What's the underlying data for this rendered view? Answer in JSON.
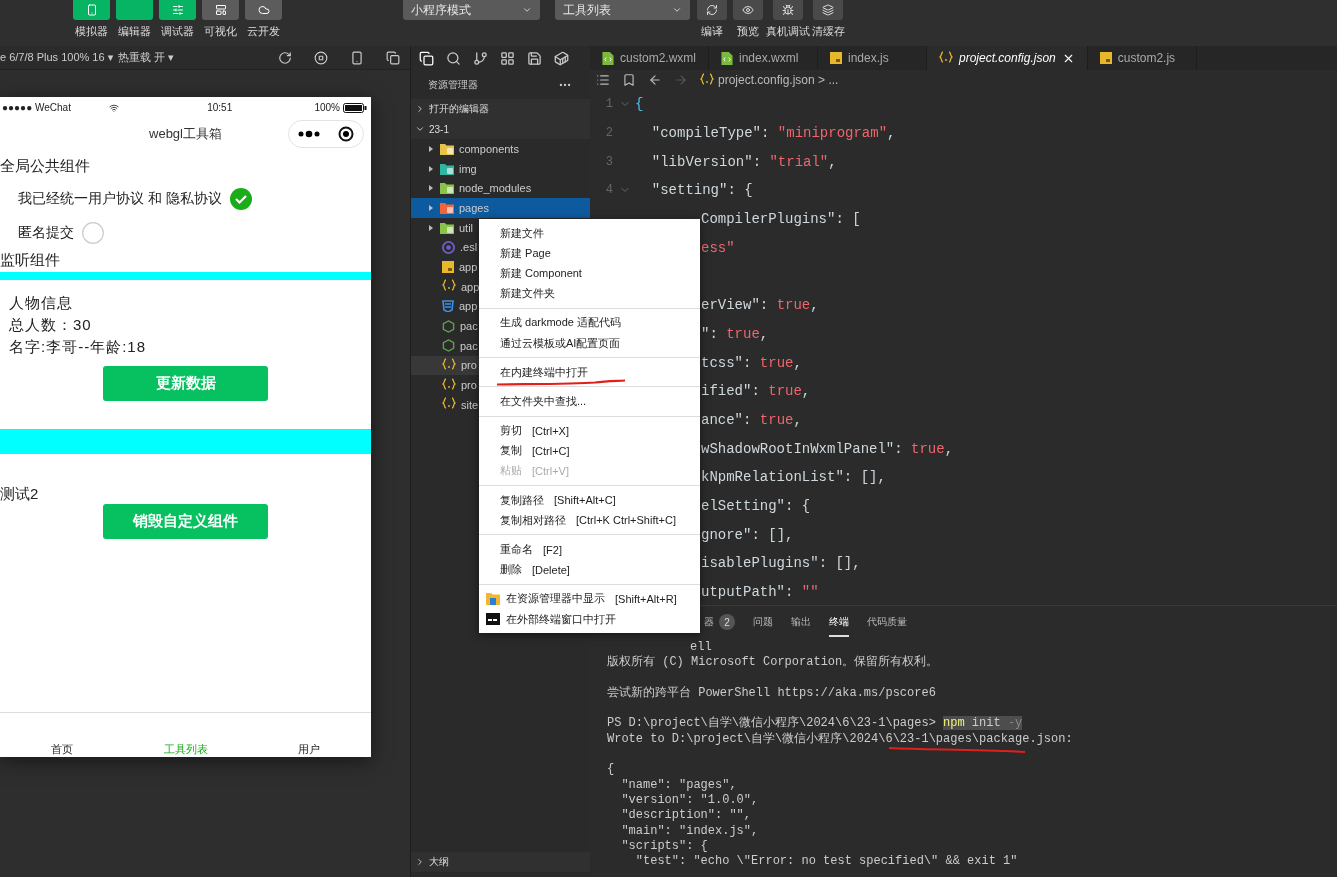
{
  "toolbar": {
    "modes": [
      {
        "label": "模拟器",
        "kind": "phone",
        "on": true
      },
      {
        "label": "编辑器",
        "kind": "code",
        "on": true
      },
      {
        "label": "调试器",
        "kind": "sliders",
        "on": true
      },
      {
        "label": "可视化",
        "kind": "layout",
        "on": false
      },
      {
        "label": "云开发",
        "kind": "cloud",
        "on": false
      }
    ],
    "dropdowns": [
      "小程序模式",
      "工具列表"
    ],
    "actions": [
      {
        "label": "编译",
        "kind": "compile"
      },
      {
        "label": "预览",
        "kind": "preview"
      },
      {
        "label": "真机调试",
        "kind": "debug"
      },
      {
        "label": "清缓存",
        "kind": "cache"
      }
    ]
  },
  "simulator_bar": {
    "device": "e 6/7/8 Plus 100% 16 ▾",
    "hot_reload": "热重载 开 ▾"
  },
  "phone": {
    "status": {
      "carrier": "●●●●● WeChat",
      "time": "10:51",
      "battery": "100%"
    },
    "title": "webgl工具箱",
    "sections": [
      {
        "kind": "heading",
        "text": "全局公共组件"
      },
      {
        "kind": "check",
        "text": "我已经统一用户协议 和 隐私协议",
        "checked": true
      },
      {
        "kind": "check",
        "text": "匿名提交",
        "checked": false
      },
      {
        "kind": "heading",
        "text": "监听组件"
      },
      {
        "kind": "bar"
      },
      {
        "kind": "info",
        "text": "人物信息"
      },
      {
        "kind": "info",
        "text": "总人数：30"
      },
      {
        "kind": "info",
        "text": "名字:李哥--年龄:18"
      },
      {
        "kind": "button",
        "text": "更新数据"
      },
      {
        "kind": "wide-bar"
      },
      {
        "kind": "heading",
        "text": "测试2"
      },
      {
        "kind": "button",
        "text": "销毁自定义组件"
      }
    ],
    "tabbar": [
      {
        "label": "首页",
        "selected": false
      },
      {
        "label": "工具列表",
        "selected": true
      },
      {
        "label": "用户",
        "selected": false
      }
    ]
  },
  "explorer": {
    "title": "资源管理器",
    "sections": [
      {
        "label": "打开的编辑器",
        "expanded": false
      },
      {
        "label": "23-1",
        "expanded": true
      }
    ],
    "tree": [
      {
        "name": "components",
        "kind": "folder",
        "color": "#e8c14a",
        "selected": false,
        "hovered": false
      },
      {
        "name": "img",
        "kind": "folder",
        "color": "#2fb5a0",
        "selected": false,
        "hovered": false
      },
      {
        "name": "node_modules",
        "kind": "folder",
        "color": "#8bc34a",
        "selected": false,
        "hovered": false
      },
      {
        "name": "pages",
        "kind": "folder",
        "color": "#f0643c",
        "selected": true,
        "hovered": false
      },
      {
        "name": "util",
        "kind": "folder",
        "color": "#8bc34a",
        "selected": false,
        "hovered": false
      },
      {
        "name": ".esl",
        "kind": "eslint",
        "selected": false,
        "hovered": false
      },
      {
        "name": "app",
        "kind": "js",
        "selected": false,
        "hovered": false
      },
      {
        "name": "app",
        "kind": "json",
        "selected": false,
        "hovered": false
      },
      {
        "name": "app",
        "kind": "css",
        "selected": false,
        "hovered": false
      },
      {
        "name": "pac",
        "kind": "node",
        "selected": false,
        "hovered": false
      },
      {
        "name": "pac",
        "kind": "node",
        "selected": false,
        "hovered": false
      },
      {
        "name": "pro",
        "kind": "json",
        "selected": false,
        "hovered": true
      },
      {
        "name": "pro",
        "kind": "json",
        "selected": false,
        "hovered": false
      },
      {
        "name": "site",
        "kind": "json",
        "selected": false,
        "hovered": false
      }
    ],
    "outline": "大纲"
  },
  "editor": {
    "tabs": [
      {
        "label": "custom2.wxml",
        "kind": "wxml",
        "selected": false
      },
      {
        "label": "index.wxml",
        "kind": "wxml",
        "selected": false
      },
      {
        "label": "index.js",
        "kind": "js",
        "selected": false
      },
      {
        "label": "project.config.json",
        "kind": "json",
        "selected": true
      },
      {
        "label": "custom2.js",
        "kind": "js",
        "selected": false
      }
    ],
    "breadcrumb": "project.config.json > ...",
    "lines": [
      {
        "number": "1",
        "fold": true,
        "kind": "full",
        "tokens": [
          {
            "text": "{",
            "kind": "brace"
          }
        ]
      },
      {
        "number": "2",
        "fold": false,
        "kind": "full",
        "tokens": [
          {
            "text": "  \"compileType\"",
            "kind": "key"
          },
          {
            "text": ": ",
            "kind": "punct"
          },
          {
            "text": "\"miniprogram\"",
            "kind": "string"
          },
          {
            "text": ",",
            "kind": "punct"
          }
        ]
      },
      {
        "number": "3",
        "fold": false,
        "kind": "full",
        "tokens": [
          {
            "text": "  \"libVersion\"",
            "kind": "key"
          },
          {
            "text": ": ",
            "kind": "punct"
          },
          {
            "text": "\"trial\"",
            "kind": "string"
          },
          {
            "text": ",",
            "kind": "punct"
          }
        ]
      },
      {
        "number": "4",
        "fold": true,
        "kind": "full",
        "tokens": [
          {
            "text": "  \"setting\"",
            "kind": "key"
          },
          {
            "text": ": {",
            "kind": "punct"
          }
        ]
      },
      {
        "kind": "covered",
        "tokens": [
          {
            "text": "CompilerPlugins\"",
            "kind": "key"
          },
          {
            "text": ": [",
            "kind": "punct"
          }
        ]
      },
      {
        "kind": "covered",
        "tokens": [
          {
            "text": "ess\"",
            "kind": "string"
          }
        ]
      },
      {
        "kind": "covered"
      },
      {
        "kind": "covered",
        "tokens": [
          {
            "text": "erView\"",
            "kind": "key"
          },
          {
            "text": ": ",
            "kind": "punct"
          },
          {
            "text": "true",
            "kind": "bool"
          },
          {
            "text": ",",
            "kind": "punct"
          }
        ]
      },
      {
        "kind": "covered",
        "tokens": [
          {
            "text": "\"",
            "kind": "key"
          },
          {
            "text": ": ",
            "kind": "punct"
          },
          {
            "text": "true",
            "kind": "bool"
          },
          {
            "text": ",",
            "kind": "punct"
          }
        ]
      },
      {
        "kind": "covered",
        "tokens": [
          {
            "text": "tcss\"",
            "kind": "key"
          },
          {
            "text": ": ",
            "kind": "punct"
          },
          {
            "text": "true",
            "kind": "bool"
          },
          {
            "text": ",",
            "kind": "punct"
          }
        ]
      },
      {
        "kind": "covered",
        "tokens": [
          {
            "text": "ified\"",
            "kind": "key"
          },
          {
            "text": ": ",
            "kind": "punct"
          },
          {
            "text": "true",
            "kind": "bool"
          },
          {
            "text": ",",
            "kind": "punct"
          }
        ]
      },
      {
        "kind": "covered",
        "tokens": [
          {
            "text": "ance\"",
            "kind": "key"
          },
          {
            "text": ": ",
            "kind": "punct"
          },
          {
            "text": "true",
            "kind": "bool"
          },
          {
            "text": ",",
            "kind": "punct"
          }
        ]
      },
      {
        "kind": "covered",
        "tokens": [
          {
            "text": "wShadowRootInWxmlPanel\"",
            "kind": "key"
          },
          {
            "text": ": ",
            "kind": "punct"
          },
          {
            "text": "true",
            "kind": "bool"
          },
          {
            "text": ",",
            "kind": "punct"
          }
        ]
      },
      {
        "kind": "covered",
        "tokens": [
          {
            "text": "kNpmRelationList\"",
            "kind": "key"
          },
          {
            "text": ": [],",
            "kind": "punct"
          }
        ]
      },
      {
        "kind": "covered",
        "tokens": [
          {
            "text": "elSetting\"",
            "kind": "key"
          },
          {
            "text": ": {",
            "kind": "punct"
          }
        ]
      },
      {
        "kind": "covered",
        "tokens": [
          {
            "text": "gnore\"",
            "kind": "key"
          },
          {
            "text": ": [],",
            "kind": "punct"
          }
        ]
      },
      {
        "kind": "covered",
        "tokens": [
          {
            "text": "isablePlugins\"",
            "kind": "key"
          },
          {
            "text": ": [],",
            "kind": "punct"
          }
        ]
      },
      {
        "kind": "covered",
        "tokens": [
          {
            "text": "utputPath\"",
            "kind": "key"
          },
          {
            "text": ": ",
            "kind": "punct"
          },
          {
            "text": "\"\"",
            "kind": "string"
          }
        ]
      }
    ]
  },
  "panel": {
    "tabs": [
      {
        "label": "器",
        "badge": "2",
        "selected": false
      },
      {
        "label": "问题",
        "selected": false
      },
      {
        "label": "输出",
        "selected": false
      },
      {
        "label": "终端",
        "selected": true
      },
      {
        "label": "代码质量",
        "selected": false
      }
    ],
    "lines": [
      {
        "kind": "covered",
        "segments": [
          {
            "text": "ell",
            "kind": "plain"
          }
        ]
      },
      {
        "kind": "text",
        "segments": [
          {
            "text": "版权所有 (C) Microsoft Corporation。保留所有权利。",
            "kind": "plain"
          }
        ]
      },
      {
        "kind": "blank"
      },
      {
        "kind": "text",
        "segments": [
          {
            "text": "尝试新的跨平台 PowerShell https://aka.ms/pscore6",
            "kind": "plain"
          }
        ]
      },
      {
        "kind": "blank"
      },
      {
        "kind": "text",
        "segments": [
          {
            "text": "PS D:\\project\\自学\\微信小程序\\2024\\6\\23-1\\pages> ",
            "kind": "plain"
          },
          {
            "text": "npm",
            "kind": "command"
          },
          {
            "text": " init ",
            "kind": "selected"
          },
          {
            "text": "-y",
            "kind": "flag"
          }
        ]
      },
      {
        "kind": "text",
        "annotated": true,
        "segments": [
          {
            "text": "Wrote to D:\\project\\自学\\微信小程序\\2024\\6\\23-1\\pages\\package.json:",
            "kind": "plain"
          }
        ]
      },
      {
        "kind": "blank"
      },
      {
        "kind": "text",
        "segments": [
          {
            "text": "{",
            "kind": "plain"
          }
        ]
      },
      {
        "kind": "text",
        "segments": [
          {
            "text": "  \"name\": \"pages\",",
            "kind": "plain"
          }
        ]
      },
      {
        "kind": "text",
        "segments": [
          {
            "text": "  \"version\": \"1.0.0\",",
            "kind": "plain"
          }
        ]
      },
      {
        "kind": "text",
        "segments": [
          {
            "text": "  \"description\": \"\",",
            "kind": "plain"
          }
        ]
      },
      {
        "kind": "text",
        "segments": [
          {
            "text": "  \"main\": \"index.js\",",
            "kind": "plain"
          }
        ]
      },
      {
        "kind": "text",
        "segments": [
          {
            "text": "  \"scripts\": {",
            "kind": "plain"
          }
        ]
      },
      {
        "kind": "text",
        "segments": [
          {
            "text": "    \"test\": \"echo \\\"Error: no test specified\\\" && exit 1\"",
            "kind": "plain"
          }
        ]
      }
    ]
  },
  "context_menu": {
    "groups": [
      [
        {
          "label": "新建文件",
          "kind": "plain",
          "disabled": false,
          "annotated": false
        },
        {
          "label": "新建 Page",
          "kind": "plain",
          "disabled": false,
          "annotated": false
        },
        {
          "label": "新建 Component",
          "kind": "plain",
          "disabled": false,
          "annotated": false
        },
        {
          "label": "新建文件夹",
          "kind": "plain",
          "disabled": false,
          "annotated": false
        }
      ],
      [
        {
          "label": "生成 darkmode 适配代码",
          "kind": "plain",
          "disabled": false,
          "annotated": false
        },
        {
          "label": "通过云模板或AI配置页面",
          "kind": "plain",
          "disabled": false,
          "annotated": false
        }
      ],
      [
        {
          "label": "在内建终端中打开",
          "kind": "plain",
          "disabled": false,
          "annotated": true
        }
      ],
      [
        {
          "label": "在文件夹中查找...",
          "kind": "plain",
          "disabled": false,
          "annotated": false
        }
      ],
      [
        {
          "label": "剪切",
          "shortcut": "[Ctrl+X]",
          "kind": "plain",
          "disabled": false,
          "annotated": false
        },
        {
          "label": "复制",
          "shortcut": "[Ctrl+C]",
          "kind": "plain",
          "disabled": false,
          "annotated": false
        },
        {
          "label": "粘贴",
          "shortcut": "[Ctrl+V]",
          "kind": "plain",
          "disabled": true,
          "annotated": false
        }
      ],
      [
        {
          "label": "复制路径",
          "shortcut": "[Shift+Alt+C]",
          "kind": "plain",
          "disabled": false,
          "annotated": false
        },
        {
          "label": "复制相对路径",
          "shortcut": "[Ctrl+K Ctrl+Shift+C]",
          "kind": "plain",
          "disabled": false,
          "annotated": false
        }
      ],
      [
        {
          "label": "重命名",
          "shortcut": "[F2]",
          "kind": "plain",
          "disabled": false,
          "annotated": false
        },
        {
          "label": "删除",
          "shortcut": "[Delete]",
          "kind": "plain",
          "disabled": false,
          "annotated": false
        }
      ],
      [
        {
          "label": "在资源管理器中显示",
          "shortcut": "[Shift+Alt+R]",
          "kind": "explorer",
          "disabled": false,
          "annotated": false
        },
        {
          "label": "在外部终端窗口中打开",
          "kind": "terminal",
          "disabled": false,
          "annotated": false
        }
      ]
    ]
  }
}
